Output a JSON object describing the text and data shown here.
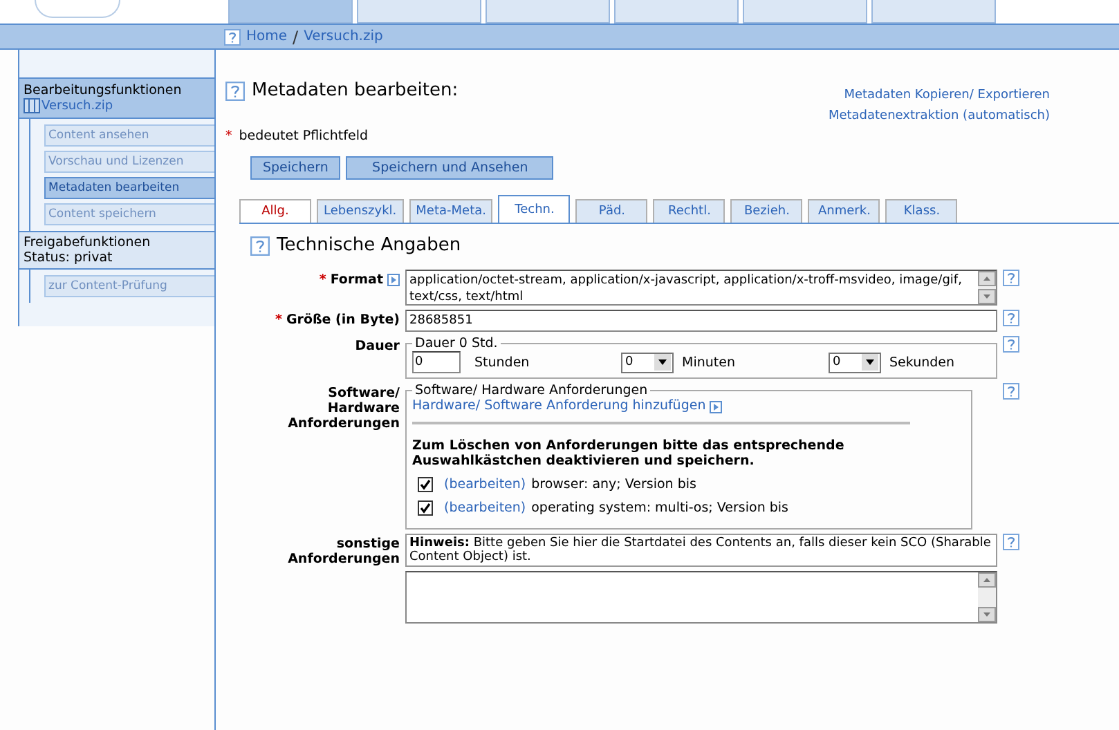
{
  "top_tabs": [
    {
      "selected": true
    },
    {
      "selected": false
    },
    {
      "selected": false
    },
    {
      "selected": false
    },
    {
      "selected": false
    },
    {
      "selected": false
    }
  ],
  "breadcrumb": [
    "Home",
    "Versuch.zip"
  ],
  "breadcrumb_separator": "/",
  "sidebar": {
    "section_title": "Bearbeitungsfunktionen",
    "file": "Versuch.zip",
    "items": [
      {
        "label": "Content ansehen",
        "selected": false,
        "disabled": true
      },
      {
        "label": "Vorschau und Lizenzen",
        "selected": false,
        "disabled": true
      },
      {
        "label": "Metadaten bearbeiten",
        "selected": true,
        "disabled": false
      },
      {
        "label": "Content speichern",
        "selected": false,
        "disabled": true
      }
    ],
    "release_title": "Freigabefunktionen",
    "status": "Status: privat",
    "release_items": [
      {
        "label": "zur Content-Prüfung",
        "selected": false,
        "disabled": true
      }
    ]
  },
  "page_title": "Metadaten bearbeiten:",
  "links": [
    "Metadaten Kopieren/ Exportieren",
    "Metadatenextraktion (automatisch)"
  ],
  "required_note": {
    "mark": "*",
    "text": "bedeutet Pflichtfeld"
  },
  "buttons": [
    "Speichern",
    "Speichern und Ansehen"
  ],
  "tabs": [
    {
      "label": "Allg.",
      "selected": false,
      "required": true
    },
    {
      "label": "Lebenszykl.",
      "selected": false,
      "required": false
    },
    {
      "label": "Meta-Meta.",
      "selected": false,
      "required": false
    },
    {
      "label": "Techn.",
      "selected": true,
      "required": false
    },
    {
      "label": "Päd.",
      "selected": false,
      "required": false
    },
    {
      "label": "Rechtl.",
      "selected": false,
      "required": false
    },
    {
      "label": "Bezieh.",
      "selected": false,
      "required": false
    },
    {
      "label": "Anmerk.",
      "selected": false,
      "required": false
    },
    {
      "label": "Klass.",
      "selected": false,
      "required": false
    }
  ],
  "section_title": "Technische Angaben",
  "format": {
    "label": "Format",
    "required": true,
    "value": "application/octet-stream, application/x-javascript, application/x-troff-msvideo, image/gif, text/css, text/html"
  },
  "size": {
    "label": "Größe (in Byte)",
    "required": true,
    "value": "28685851"
  },
  "duration": {
    "label": "Dauer",
    "legend": "Dauer 0 Std.",
    "hours": "0",
    "hours_unit": "Stunden",
    "minutes": "0",
    "minutes_unit": "Minuten",
    "seconds": "0",
    "seconds_unit": "Sekunden"
  },
  "requirements": {
    "label": "Software/ Hardware Anforderungen",
    "legend": "Software/ Hardware Anforderungen",
    "add_link": "Hardware/ Software Anforderung hinzufügen",
    "instruction": "Zum Löschen von Anforderungen bitte das entsprechende Auswahlkästchen deaktivieren und speichern.",
    "entries": [
      {
        "edit": "(bearbeiten)",
        "text": "browser: any; Version bis",
        "checked": true
      },
      {
        "edit": "(bearbeiten)",
        "text": "operating system: multi-os; Version bis",
        "checked": true
      }
    ]
  },
  "other": {
    "label": "sonstige Anforderungen",
    "hint": "**Hinweis:** Bitte geben Sie hier die Startdatei des Contents an, falls dieser kein SCO (Sharable Content Object) ist."
  }
}
